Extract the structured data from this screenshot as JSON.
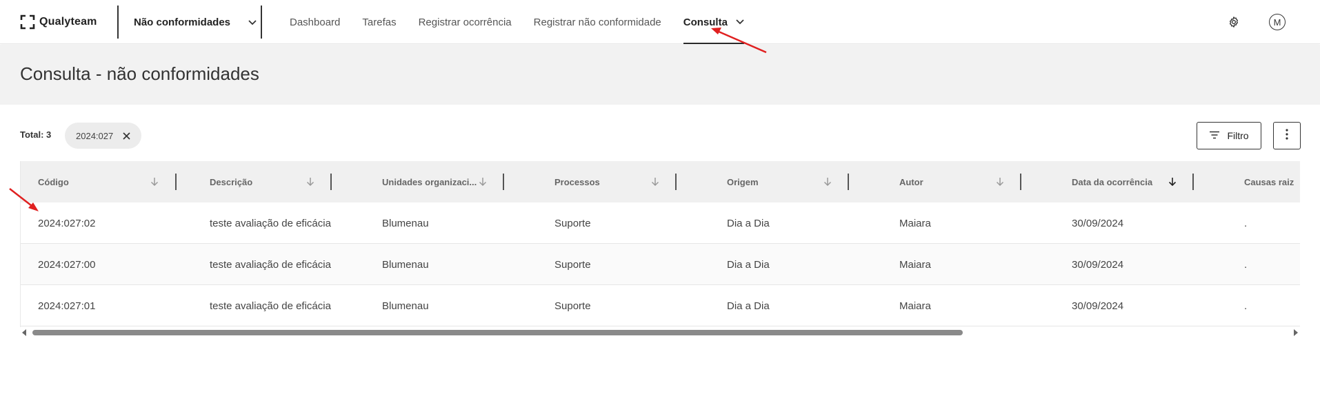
{
  "header": {
    "logo_text": "Qualyteam",
    "module_label": "Não conformidades",
    "nav": [
      {
        "label": "Dashboard",
        "active": false
      },
      {
        "label": "Tarefas",
        "active": false
      },
      {
        "label": "Registrar ocorrência",
        "active": false
      },
      {
        "label": "Registrar não conformidade",
        "active": false
      },
      {
        "label": "Consulta",
        "active": true
      }
    ],
    "settings_icon": "gear-icon",
    "avatar_initial": "M"
  },
  "page": {
    "title": "Consulta - não conformidades"
  },
  "toolbar": {
    "total_label": "Total: 3",
    "filter_chip": "2024:027",
    "filter_button": "Filtro"
  },
  "table": {
    "columns": [
      "Código",
      "Descrição",
      "Unidades organizaci...",
      "Processos",
      "Origem",
      "Autor",
      "Data da ocorrência",
      "Causas raiz"
    ],
    "rows": [
      [
        "2024:027:02",
        "teste avaliação de eficácia",
        "Blumenau",
        "Suporte",
        "Dia a Dia",
        "Maiara",
        "30/09/2024",
        "."
      ],
      [
        "2024:027:00",
        "teste avaliação de eficácia",
        "Blumenau",
        "Suporte",
        "Dia a Dia",
        "Maiara",
        "30/09/2024",
        "."
      ],
      [
        "2024:027:01",
        "teste avaliação de eficácia",
        "Blumenau",
        "Suporte",
        "Dia a Dia",
        "Maiara",
        "30/09/2024",
        "."
      ]
    ]
  },
  "colors": {
    "annotation_arrow": "#e02020",
    "title_band": "#f2f2f2",
    "chip_bg": "#ececec"
  }
}
